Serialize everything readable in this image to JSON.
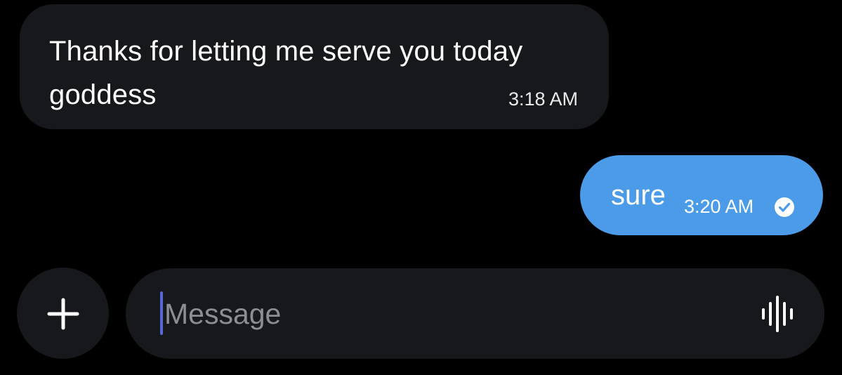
{
  "conversation": {
    "messages": [
      {
        "direction": "incoming",
        "text": "Thanks for letting me serve you today goddess",
        "time": "3:18 AM"
      },
      {
        "direction": "outgoing",
        "text": "sure",
        "time": "3:20 AM",
        "status_icon": "check-circle-icon"
      }
    ]
  },
  "composer": {
    "add_icon": "plus-icon",
    "placeholder": "Message",
    "value": "",
    "voice_icon": "voice-waveform-icon"
  },
  "colors": {
    "background": "#000000",
    "incoming_bubble": "#17181c",
    "outgoing_bubble": "#4c9be8",
    "caret": "#5a67d8",
    "placeholder": "#8b8e93"
  }
}
